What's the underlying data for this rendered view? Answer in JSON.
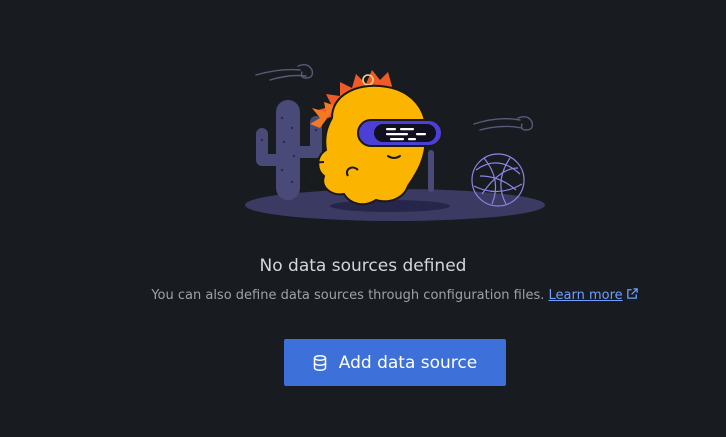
{
  "empty_state": {
    "title": "No data sources defined",
    "description": "You can also define data sources through configuration files.",
    "learn_more_label": "Learn more",
    "illustration_icon": "grafana-mascot-desert-illustration",
    "external_link_icon": "external-link-icon"
  },
  "actions": {
    "add_data_source_label": "Add data source",
    "add_data_source_icon": "database-icon"
  },
  "colors": {
    "background": "#181b1f",
    "primary_button": "#3d71d9",
    "link": "#6e9fff",
    "title_text": "#d3d6dc",
    "secondary_text": "#9ea1a9"
  }
}
